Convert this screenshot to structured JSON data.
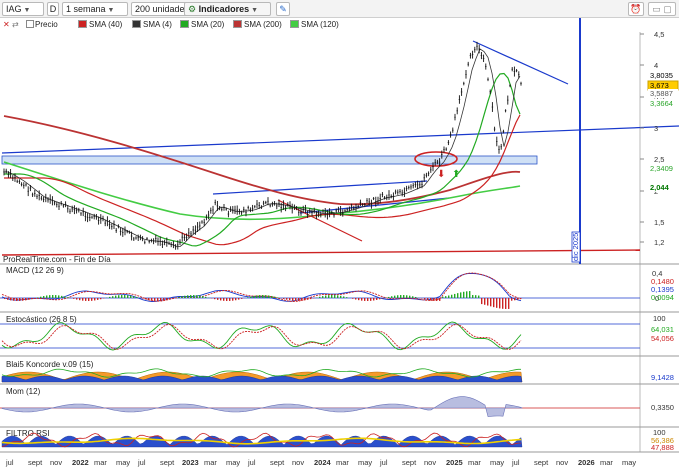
{
  "toolbar": {
    "symbol": "IAG",
    "period_code": "D",
    "interval": "1 semana",
    "units": "200 unidades",
    "indicators_label": "Indicadores"
  },
  "legend": {
    "items": [
      "Precio",
      "SMA (40)",
      "SMA (4)",
      "SMA (20)",
      "SMA (200)",
      "SMA (120)"
    ]
  },
  "source_text": "ProRealTime.com - Fin de Día",
  "vline_label": "dic 2025",
  "price_axis": {
    "ticks": [
      "4,5",
      "4",
      "3,5",
      "3",
      "2,5",
      "2",
      "1,5",
      "1,2"
    ],
    "tags": [
      {
        "value": "3,8035",
        "color": "#ffffff",
        "text": "#000000"
      },
      {
        "value": "3,673",
        "color": "#ffcc00",
        "text": "#000000"
      },
      {
        "value": "3,5887",
        "color": "#ffffff",
        "text": "#555555"
      },
      {
        "value": "3,3664",
        "color": "#ffffff",
        "text": "#2aa52a"
      },
      {
        "value": "2,3409",
        "color": "#ffffff",
        "text": "#2aa52a"
      },
      {
        "value": "2,044",
        "color": "#ffffff",
        "text": "#007700"
      }
    ]
  },
  "panels": {
    "macd": {
      "title": "MACD (12 26 9)",
      "ticks": [
        "0,4",
        "0"
      ],
      "tags": [
        "0,1480",
        "0,1395",
        "0,0094"
      ]
    },
    "stoch": {
      "title": "Estocástico (26 8 5)",
      "ticks": [
        "100",
        "0"
      ],
      "tags": [
        "64,031",
        "54,056"
      ]
    },
    "blai": {
      "title": "Blai5 Koncorde v.09 (15)",
      "ticks": [
        "0"
      ],
      "tags": [
        "9,1428"
      ]
    },
    "mom": {
      "title": "Mom (12)",
      "ticks": [
        "0"
      ],
      "tags": [
        "0,3350"
      ]
    },
    "filtro": {
      "title": "FILTRO RSI",
      "ticks": [
        "100"
      ],
      "tags": [
        "56,386",
        "47,888"
      ]
    }
  },
  "x_axis": [
    "jul",
    "sept",
    "nov",
    "2022",
    "mar",
    "may",
    "jul",
    "sept",
    "2023",
    "mar",
    "may",
    "jul",
    "sept",
    "nov",
    "2024",
    "mar",
    "may",
    "jul",
    "sept",
    "nov",
    "2025",
    "mar",
    "may",
    "jul",
    "sept",
    "nov",
    "2026",
    "mar",
    "may"
  ],
  "colors": {
    "sma40": "#cc2222",
    "sma4": "#333333",
    "sma20": "#22aa22",
    "sma200": "#bb3333",
    "sma120": "#44cc44",
    "trend": "#1a3acc",
    "accent": "#1a3acc"
  }
}
